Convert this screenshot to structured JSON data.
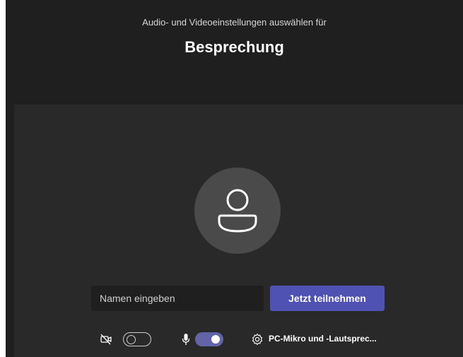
{
  "header": {
    "subtitle": "Audio- und Videoeinstellungen auswählen für",
    "title": "Besprechung"
  },
  "prejoin": {
    "avatar_icon": "person-icon",
    "name_placeholder": "Namen eingeben",
    "name_value": "",
    "join_label": "Jetzt teilnehmen"
  },
  "controls": {
    "camera": {
      "icon": "camera-off-icon",
      "enabled": false
    },
    "microphone": {
      "icon": "microphone-icon",
      "enabled": true
    },
    "device_settings": {
      "icon": "gear-icon",
      "label": "PC-Mikro und -Lautsprec..."
    }
  },
  "colors": {
    "background": "#1f1f1f",
    "stage": "#292929",
    "accent": "#4f52b2",
    "toggle_on": "#6264a7",
    "avatar": "#4a4a4a"
  }
}
